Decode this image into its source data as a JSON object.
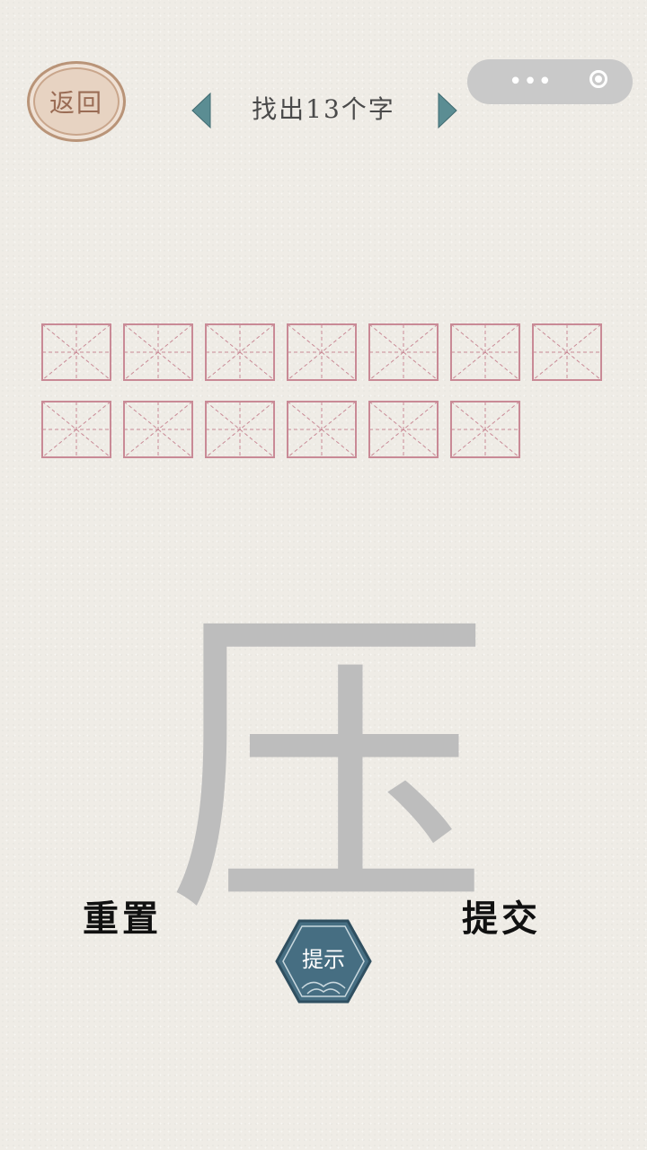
{
  "header": {
    "back_label": "返回",
    "level_title": "找出13个字",
    "capsule_dots": "•••",
    "capsule_icon": "target-icon"
  },
  "board": {
    "cell_rows": [
      7,
      6
    ],
    "cell_line_color": "#c98a96"
  },
  "main_character": "压",
  "actions": {
    "reset_label": "重置",
    "submit_label": "提交",
    "hint_label": "提示"
  },
  "colors": {
    "accent_arrow": "#5b8d93",
    "hint_fill": "#466e82",
    "back_fill": "#e7d3c2",
    "character_gray": "#bdbdbd"
  }
}
